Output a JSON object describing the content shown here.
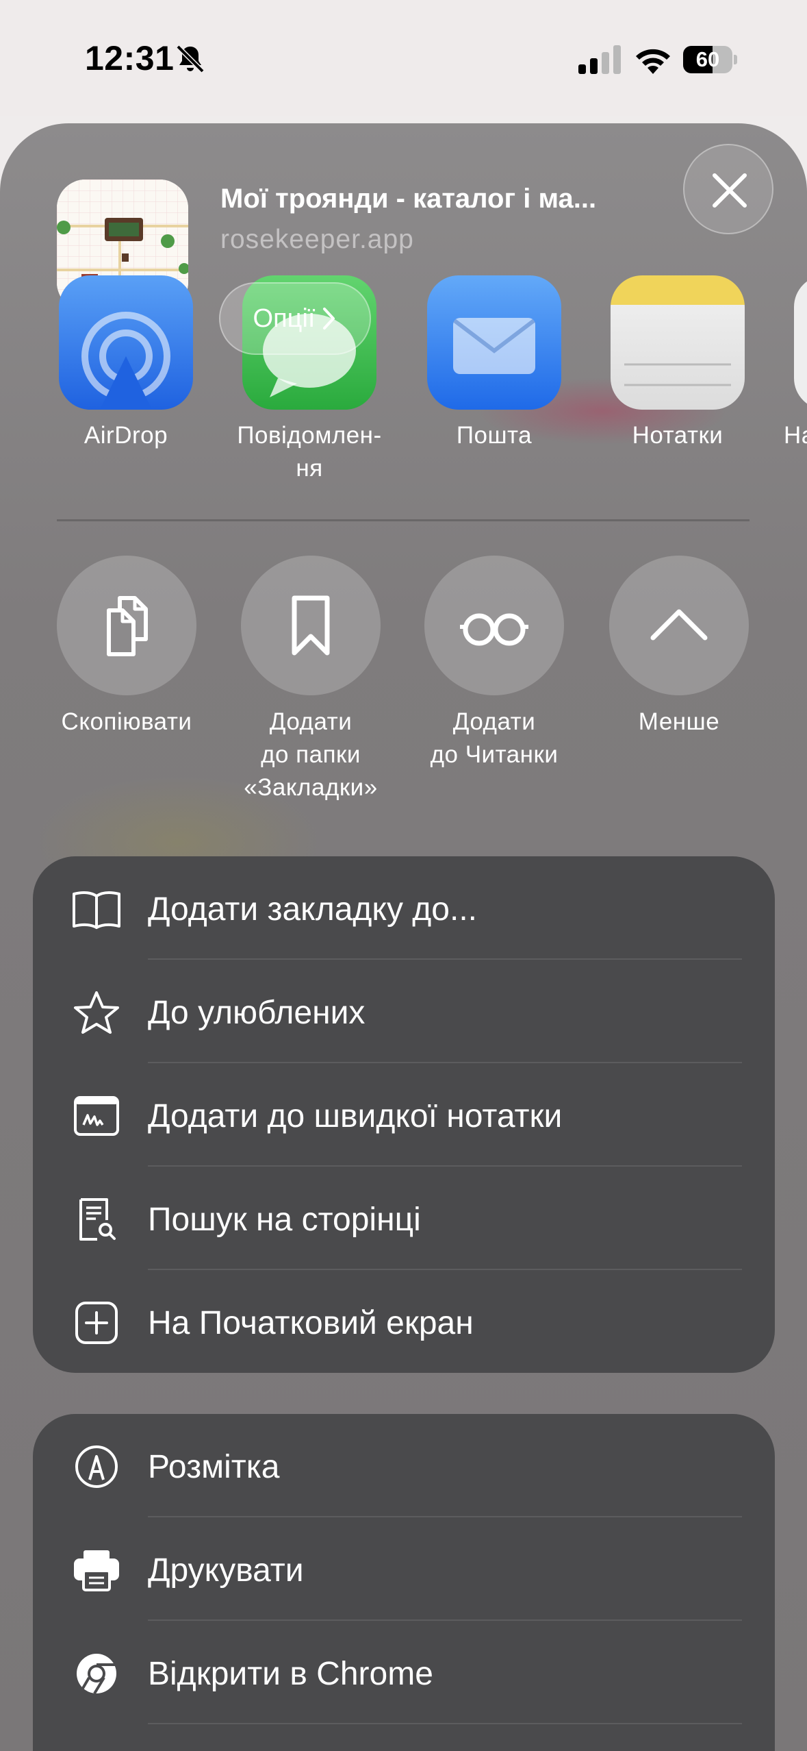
{
  "status_bar": {
    "time": "12:31",
    "battery_percent": "60",
    "battery_level": 0.6,
    "icons": [
      "bell-slash-icon",
      "signal-icon",
      "wifi-icon",
      "battery-icon"
    ]
  },
  "share_header": {
    "title": "Мої троянди - каталог і ма...",
    "url": "rosekeeper.app",
    "options_label": "Опції",
    "close_icon": "close-icon"
  },
  "apps": [
    {
      "label": "AirDrop",
      "icon": "airdrop-icon",
      "color": "#2f7bf5"
    },
    {
      "label": "Повідомлен-\nня",
      "icon": "messages-icon",
      "color": "#36c64a"
    },
    {
      "label": "Пошта",
      "icon": "mail-icon",
      "color": "#3a8af7"
    },
    {
      "label": "Нотатки",
      "icon": "notes-icon",
      "color": "#f3d24c"
    },
    {
      "label": "На",
      "icon": "reminders-icon",
      "color": "#ffffff"
    }
  ],
  "actions": [
    {
      "label": "Скопіювати",
      "icon": "copy-icon"
    },
    {
      "label": "Додати\nдо папки\n«Закладки»",
      "icon": "bookmark-icon"
    },
    {
      "label": "Додати\nдо Читанки",
      "icon": "glasses-icon"
    },
    {
      "label": "Менше",
      "icon": "chevron-up-icon"
    }
  ],
  "menu_group_1": [
    {
      "label": "Додати закладку до...",
      "icon": "book-icon"
    },
    {
      "label": "До улюблених",
      "icon": "star-icon"
    },
    {
      "label": "Додати до швидкої нотатки",
      "icon": "quick-note-icon"
    },
    {
      "label": "Пошук на сторінці",
      "icon": "find-on-page-icon"
    },
    {
      "label": "На Початковий екран",
      "icon": "add-square-icon"
    }
  ],
  "menu_group_2": [
    {
      "label": "Розмітка",
      "icon": "markup-icon"
    },
    {
      "label": "Друкувати",
      "icon": "printer-icon"
    },
    {
      "label": "Відкрити в Chrome",
      "icon": "chrome-icon"
    }
  ]
}
